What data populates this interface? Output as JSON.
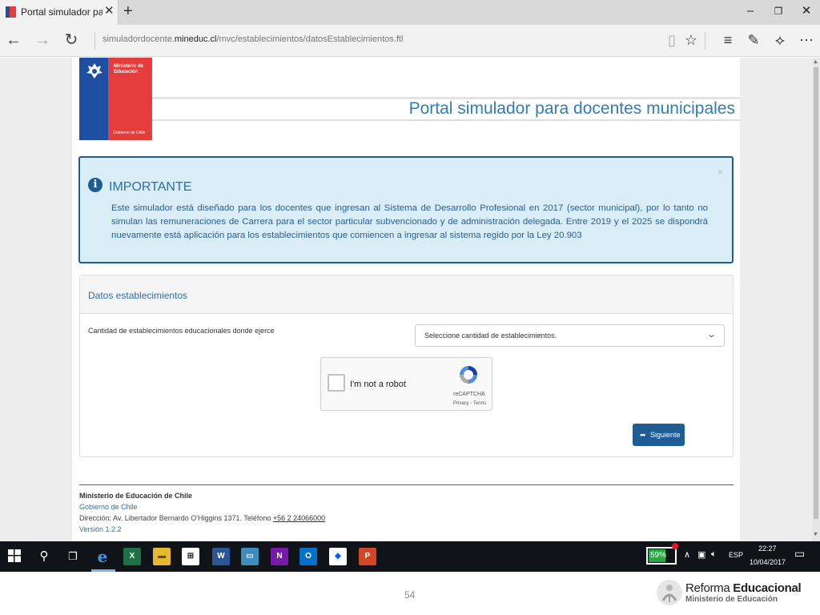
{
  "browser": {
    "tab_title": "Portal simulador para do",
    "url_prefix": "simuladordocente.",
    "url_domain": "mineduc.cl",
    "url_path": "/mvc/establecimientos/datosEstablecimientos.ftl"
  },
  "logo": {
    "ministry_line": "Ministerio de Educación",
    "gov_line": "Gobierno de Chile"
  },
  "header": {
    "title": "Portal simulador para docentes municipales"
  },
  "alert": {
    "title": "IMPORTANTE",
    "text": "Este simulador está diseñado para los docentes que ingresan al Sistema de Desarrollo Profesional en 2017 (sector municipal), por lo tanto no simulan las remuneraciones de Carrera para el sector particular subvencionado y de administración delegada. Entre 2019 y el 2025 se dispondrá nuevamente está aplicación para los establecimientos que comiencen a ingresar al sistema regido por la Ley 20.903"
  },
  "panel": {
    "title": "Datos establecimientos",
    "field_label": "Cantidad de establecimientos educacionales donde ejerce",
    "select_value": "Seleccione cantidad de establecimientos."
  },
  "captcha": {
    "label": "I'm not a robot",
    "brand": "reCAPTCHA",
    "terms": "Privacy - Terms"
  },
  "next_button": "Siguiente",
  "footer": {
    "ministry": "Ministerio de Educación de Chile",
    "government": "Gobierno de Chile",
    "address": "Dirección: Av. Libertador Bernardo O'Higgins 1371. Teléfono ",
    "phone": "+56 2 24066000",
    "version": "Versión 1.2.2"
  },
  "taskbar": {
    "battery": "59%",
    "lang": "ESP",
    "time": "22:27",
    "date": "10/04/2017"
  },
  "slide": {
    "page_number": "54",
    "brand_a": "Reforma ",
    "brand_b": "Educacional",
    "brand_sub": "Ministerio de Educación"
  },
  "colors": {
    "accent_blue": "#1e5d93",
    "title_blue": "#2f7db8",
    "logo_red": "#e53c3c",
    "logo_blue": "#1f4fa3",
    "alert_bg": "#d9edf7"
  }
}
